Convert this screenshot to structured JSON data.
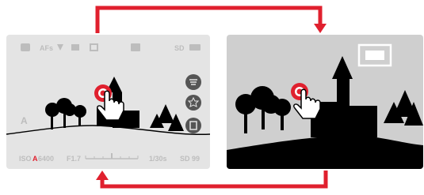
{
  "colors": {
    "arrow": "#e0202e",
    "touch_point": "#e0202e",
    "live_view_bg": "#e4e4e4",
    "playback_bg": "#cfcfcf",
    "status_icons": "#bdbdbd",
    "silhouette": "#000000"
  },
  "live_view": {
    "top_status_bar": {
      "icons": [
        "camera-mode-icon",
        "autofocus-icon",
        "focus-peaking-icon",
        "exposure-icon",
        "drive-mode-icon",
        "memory-card-icon",
        "battery-icon"
      ],
      "af_label": "AFs",
      "sd_label": "SD"
    },
    "bottom_status_bar": {
      "iso": "ISO",
      "auto_mark": "A",
      "iso_value": "6400",
      "aperture": "F1.7",
      "shutter": "1/30s",
      "shots_remaining": "SD 99"
    },
    "left_mode_label": "A",
    "side_buttons": [
      "menu-icon",
      "favorite-star-icon",
      "delete-icon"
    ]
  },
  "playback_view": {
    "thumbnail_indicator": "thumbnail-frame-icon"
  },
  "flow": {
    "top_arrow": "live-view-to-playback-arrow",
    "bottom_arrow": "playback-to-live-view-arrow"
  }
}
